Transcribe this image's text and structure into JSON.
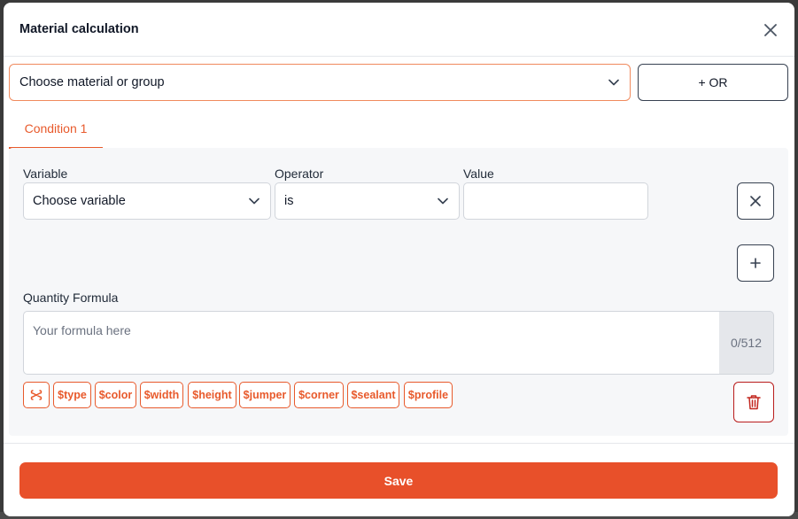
{
  "modal": {
    "title": "Material calculation"
  },
  "material_select": {
    "value": "Choose material or group"
  },
  "or_button": {
    "label": "+ OR"
  },
  "tabs": [
    {
      "label": "Condition 1",
      "active": true
    }
  ],
  "condition": {
    "variable_label": "Variable",
    "variable_value": "Choose variable",
    "operator_label": "Operator",
    "operator_value": "is",
    "value_label": "Value",
    "value_value": ""
  },
  "formula": {
    "label": "Quantity Formula",
    "placeholder": "Your formula here",
    "counter": "0/512"
  },
  "variables": [
    "$type",
    "$color",
    "$width",
    "$height",
    "$jumper",
    "$corner",
    "$sealant",
    "$profile"
  ],
  "footer": {
    "save_label": "Save"
  },
  "colors": {
    "accent": "#e8502a",
    "danger": "#b91c1c"
  }
}
